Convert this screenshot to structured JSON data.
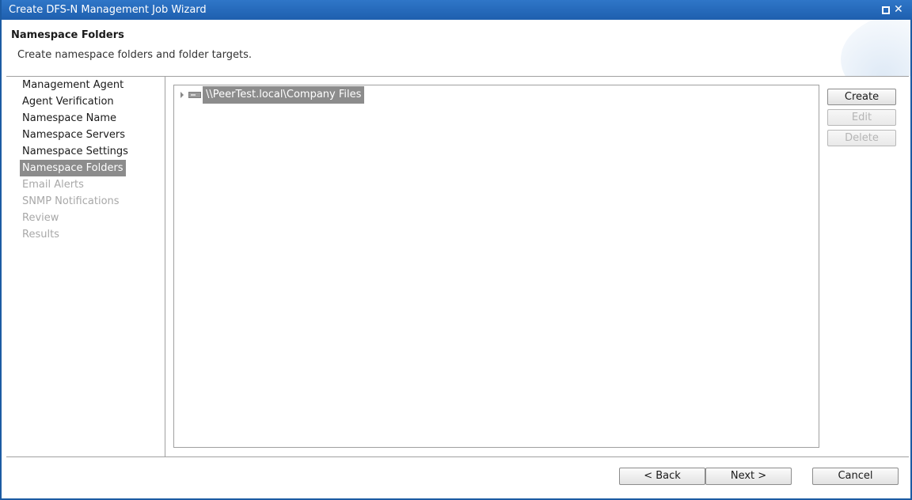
{
  "window": {
    "title": "Create DFS-N Management Job Wizard",
    "maximize_icon": "maximize-icon",
    "close_icon": "close-icon",
    "close_glyph": "✕"
  },
  "header": {
    "title": "Namespace Folders",
    "description": "Create namespace folders and folder targets."
  },
  "nav": {
    "items": [
      {
        "label": "Management Agent",
        "state": "done"
      },
      {
        "label": "Agent Verification",
        "state": "done"
      },
      {
        "label": "Namespace Name",
        "state": "done"
      },
      {
        "label": "Namespace Servers",
        "state": "done"
      },
      {
        "label": "Namespace Settings",
        "state": "done"
      },
      {
        "label": "Namespace Folders",
        "state": "active"
      },
      {
        "label": "Email Alerts",
        "state": "pending"
      },
      {
        "label": "SNMP Notifications",
        "state": "pending"
      },
      {
        "label": "Review",
        "state": "pending"
      },
      {
        "label": "Results",
        "state": "pending"
      }
    ]
  },
  "tree": {
    "root": {
      "label": "\\\\PeerTest.local\\Company Files",
      "icon": "namespace-server-icon",
      "expanded": false,
      "selected": true
    }
  },
  "actions": {
    "create": {
      "label": "Create",
      "enabled": true
    },
    "edit": {
      "label": "Edit",
      "enabled": false
    },
    "delete": {
      "label": "Delete",
      "enabled": false
    }
  },
  "footer": {
    "back": "< Back",
    "next": "Next >",
    "cancel": "Cancel"
  },
  "colors": {
    "titlebar": "#1e5fae",
    "selection": "#8c8c8c",
    "disabled_text": "#a8a8a8"
  }
}
